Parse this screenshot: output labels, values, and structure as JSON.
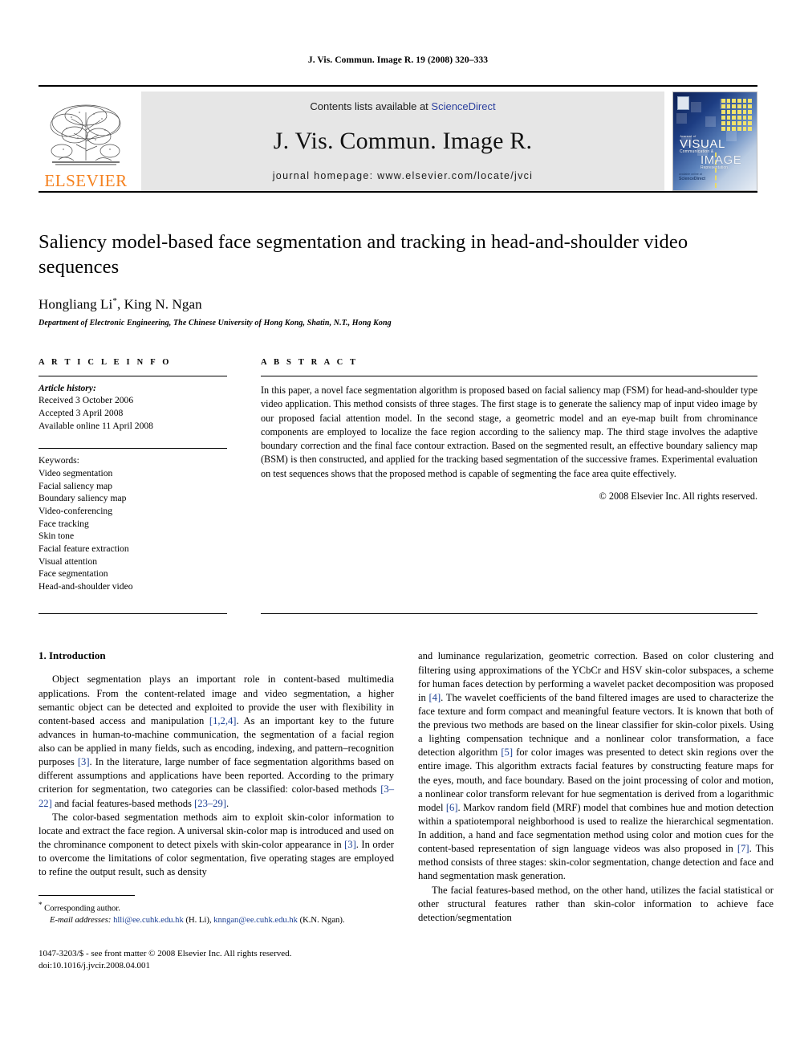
{
  "running_head": "J. Vis. Commun. Image R. 19 (2008) 320–333",
  "masthead": {
    "contents_prefix": "Contents lists available at ",
    "sciencedirect": "ScienceDirect",
    "journal_title": "J. Vis. Commun. Image R.",
    "homepage": "journal homepage: www.elsevier.com/locate/jvci",
    "publisher_wordmark": "ELSEVIER",
    "accent_color": "#F58220",
    "link_color": "#2b3f9e",
    "banner_color": "#e6e6e6",
    "cover": {
      "line1": "Journal of",
      "line2": "VISUAL",
      "line3": "Communication &",
      "line4": "IMAGE",
      "line5": "Representation",
      "sciencedirect_mark": "ScienceDirect",
      "available_online": "available online at"
    }
  },
  "article": {
    "title": "Saliency model-based face segmentation and tracking in head-and-shoulder video sequences",
    "authors": "Hongliang Li",
    "author_marker": "*",
    "authors_rest": ", King N. Ngan",
    "affiliation": "Department of Electronic Engineering, The Chinese University of Hong Kong, Shatin, N.T., Hong Kong"
  },
  "info": {
    "heading": "A R T I C L E   I N F O",
    "history_label": "Article history:",
    "history": [
      "Received 3 October 2006",
      "Accepted 3 April 2008",
      "Available online 11 April 2008"
    ],
    "keywords_label": "Keywords:",
    "keywords": [
      "Video segmentation",
      "Facial saliency map",
      "Boundary saliency map",
      "Video-conferencing",
      "Face tracking",
      "Skin tone",
      "Facial feature extraction",
      "Visual attention",
      "Face segmentation",
      "Head-and-shoulder video"
    ]
  },
  "abstract": {
    "heading": "A B S T R A C T",
    "text": "In this paper, a novel face segmentation algorithm is proposed based on facial saliency map (FSM) for head-and-shoulder type video application. This method consists of three stages. The first stage is to generate the saliency map of input video image by our proposed facial attention model. In the second stage, a geometric model and an eye-map built from chrominance components are employed to localize the face region according to the saliency map. The third stage involves the adaptive boundary correction and the final face contour extraction. Based on the segmented result, an effective boundary saliency map (BSM) is then constructed, and applied for the tracking based segmentation of the successive frames. Experimental evaluation on test sequences shows that the proposed method is capable of segmenting the face area quite effectively.",
    "copyright": "© 2008 Elsevier Inc. All rights reserved."
  },
  "introduction": {
    "heading": "1. Introduction",
    "left_paragraphs": [
      {
        "segments": [
          {
            "t": "Object segmentation plays an important role in content-based multimedia applications. From the content-related image and video segmentation, a higher semantic object can be detected and exploited to provide the user with flexibility in content-based access and manipulation "
          },
          {
            "t": "[1,2,4]",
            "cite": true
          },
          {
            "t": ". As an important key to the future advances in human-to-machine communication, the segmentation of a facial region also can be applied in many fields, such as encoding, indexing, and pattern–recognition purposes "
          },
          {
            "t": "[3]",
            "cite": true
          },
          {
            "t": ". In the literature, large number of face segmentation algorithms based on different assumptions and applications have been reported. According to the primary criterion for segmentation, two categories can be classified: color-based methods "
          },
          {
            "t": "[3–22]",
            "cite": true
          },
          {
            "t": " and facial features-based methods "
          },
          {
            "t": "[23–29]",
            "cite": true
          },
          {
            "t": "."
          }
        ]
      },
      {
        "segments": [
          {
            "t": "The color-based segmentation methods aim to exploit skin-color information to locate and extract the face region. A universal skin-color map is introduced and used on the chrominance component to detect pixels with skin-color appearance in "
          },
          {
            "t": "[3]",
            "cite": true
          },
          {
            "t": ". In order to overcome the limitations of color segmentation, five operating stages are employed to refine the output result, such as density"
          }
        ]
      }
    ],
    "right_paragraphs": [
      {
        "segments": [
          {
            "t": "and luminance regularization, geometric correction. Based on color clustering and filtering using approximations of the YCbCr and HSV skin-color subspaces, a scheme for human faces detection by performing a wavelet packet decomposition was proposed in "
          },
          {
            "t": "[4]",
            "cite": true
          },
          {
            "t": ". The wavelet coefficients of the band filtered images are used to characterize the face texture and form compact and meaningful feature vectors. It is known that both of the previous two methods are based on the linear classifier for skin-color pixels. Using a lighting compensation technique and a nonlinear color transformation, a face detection algorithm "
          },
          {
            "t": "[5]",
            "cite": true
          },
          {
            "t": " for color images was presented to detect skin regions over the entire image. This algorithm extracts facial features by constructing feature maps for the eyes, mouth, and face boundary. Based on the joint processing of color and motion, a nonlinear color transform relevant for hue segmentation is derived from a logarithmic model "
          },
          {
            "t": "[6]",
            "cite": true
          },
          {
            "t": ". Markov random field (MRF) model that combines hue and motion detection within a spatiotemporal neighborhood is used to realize the hierarchical segmentation. In addition, a hand and face segmentation method using color and motion cues for the content-based representation of sign language videos was also proposed in "
          },
          {
            "t": "[7]",
            "cite": true
          },
          {
            "t": ". This method consists of three stages: skin-color segmentation, change detection and face and hand segmentation mask generation."
          }
        ]
      },
      {
        "segments": [
          {
            "t": "The facial features-based method, on the other hand, utilizes the facial statistical or other structural features rather than skin-color information to achieve face detection/segmentation"
          }
        ]
      }
    ]
  },
  "footnotes": {
    "corresponding": "Corresponding author.",
    "email_label": "E-mail addresses:",
    "email1": "hlli@ee.cuhk.edu.hk",
    "email1_name": "(H. Li),",
    "email2": "knngan@ee.cuhk.edu.hk",
    "email2_name": "(K.N. Ngan).",
    "issn_line": "1047-3203/$ - see front matter © 2008 Elsevier Inc. All rights reserved.",
    "doi_line": "doi:10.1016/j.jvcir.2008.04.001"
  }
}
